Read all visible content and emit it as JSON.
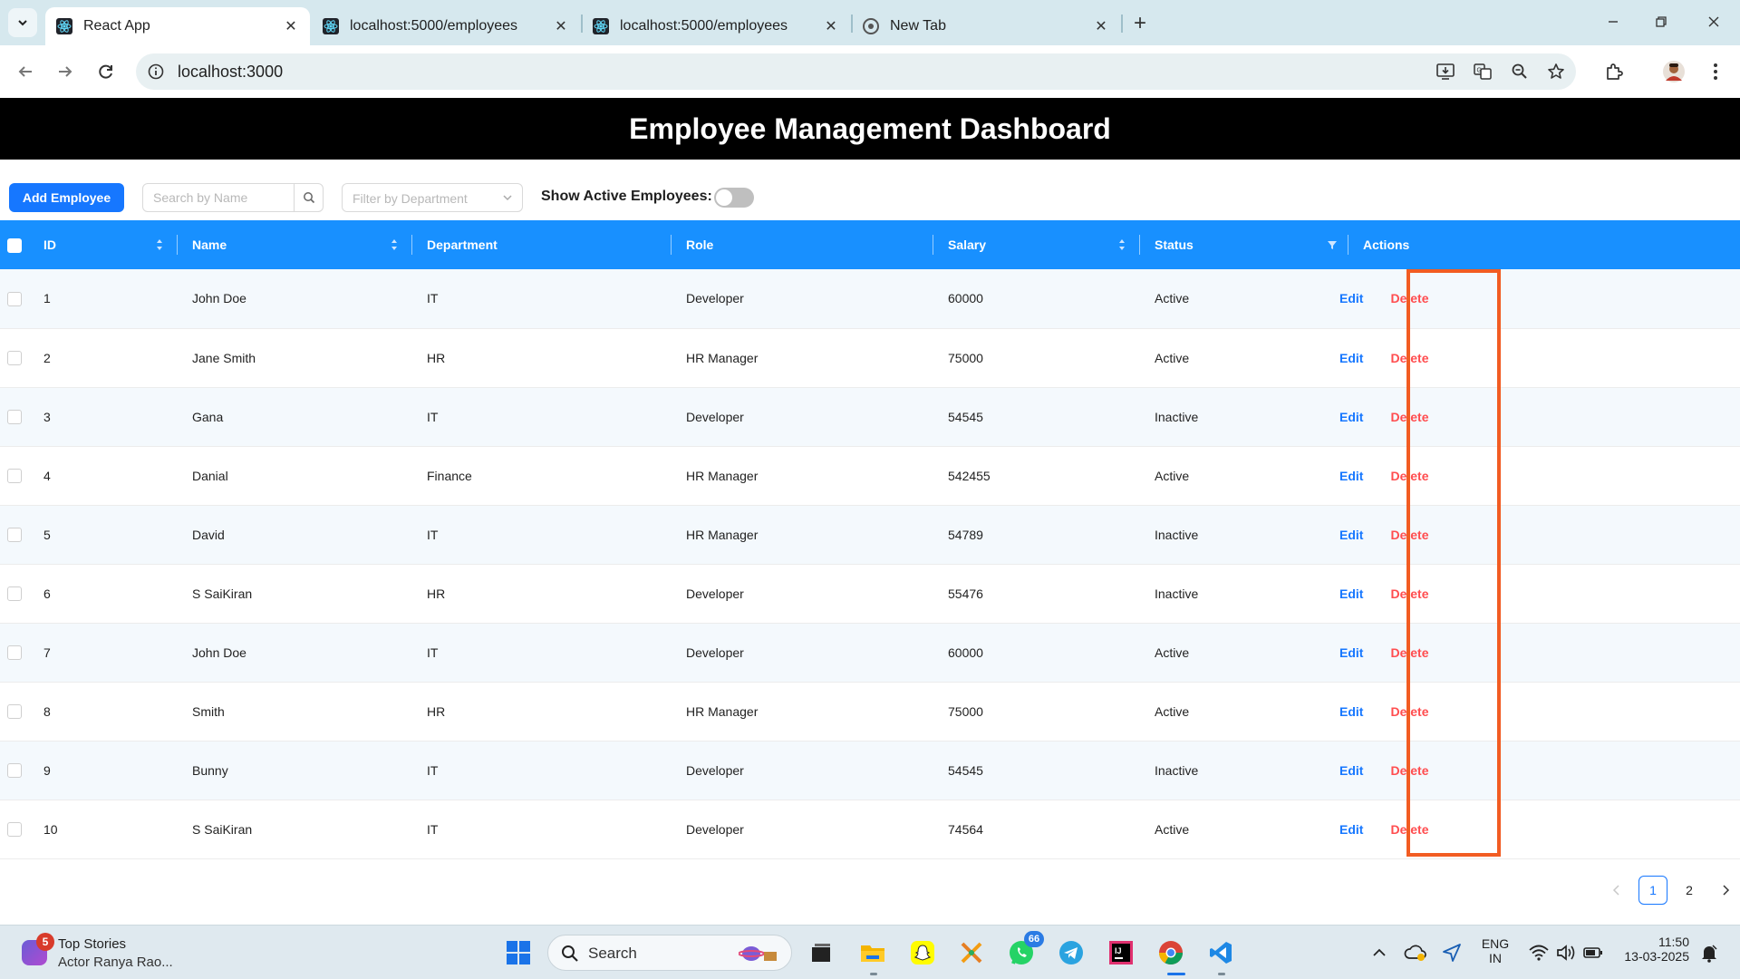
{
  "browser": {
    "tabs": [
      {
        "title": "React App",
        "active": true,
        "icon": "react-icon"
      },
      {
        "title": "localhost:5000/employees",
        "active": false,
        "icon": "react-icon"
      },
      {
        "title": "localhost:5000/employees",
        "active": false,
        "icon": "react-icon"
      },
      {
        "title": "New Tab",
        "active": false,
        "icon": "chrome-icon"
      }
    ],
    "url": "localhost:3000"
  },
  "app": {
    "title": "Employee Management Dashboard",
    "add_button": "Add Employee",
    "search_placeholder": "Search by Name",
    "department_placeholder": "Filter by Department",
    "active_toggle_label": "Show Active Employees:",
    "active_toggle_on": false,
    "columns": [
      "ID",
      "Name",
      "Department",
      "Role",
      "Salary",
      "Status",
      "Actions"
    ],
    "edit_label": "Edit",
    "delete_label": "Delete",
    "rows": [
      {
        "id": "1",
        "name": "John Doe",
        "department": "IT",
        "role": "Developer",
        "salary": "60000",
        "status": "Active"
      },
      {
        "id": "2",
        "name": "Jane Smith",
        "department": "HR",
        "role": "HR Manager",
        "salary": "75000",
        "status": "Active"
      },
      {
        "id": "3",
        "name": "Gana",
        "department": "IT",
        "role": "Developer",
        "salary": "54545",
        "status": "Inactive"
      },
      {
        "id": "4",
        "name": "Danial",
        "department": "Finance",
        "role": "HR Manager",
        "salary": "542455",
        "status": "Active"
      },
      {
        "id": "5",
        "name": "David",
        "department": "IT",
        "role": "HR Manager",
        "salary": "54789",
        "status": "Inactive"
      },
      {
        "id": "6",
        "name": "S SaiKiran",
        "department": "HR",
        "role": "Developer",
        "salary": "55476",
        "status": "Inactive"
      },
      {
        "id": "7",
        "name": "John Doe",
        "department": "IT",
        "role": "Developer",
        "salary": "60000",
        "status": "Active"
      },
      {
        "id": "8",
        "name": "Smith",
        "department": "HR",
        "role": "HR Manager",
        "salary": "75000",
        "status": "Active"
      },
      {
        "id": "9",
        "name": "Bunny",
        "department": "IT",
        "role": "Developer",
        "salary": "54545",
        "status": "Inactive"
      },
      {
        "id": "10",
        "name": "S SaiKiran",
        "department": "IT",
        "role": "Developer",
        "salary": "74564",
        "status": "Active"
      }
    ],
    "pagination": {
      "pages": [
        "1",
        "2"
      ],
      "current": "1"
    },
    "colors": {
      "header_bg": "#000000",
      "table_header": "#1890ff",
      "primary": "#1677ff",
      "danger": "#ff4d4f",
      "highlight": "#f25c22"
    }
  },
  "taskbar": {
    "news_badge": "5",
    "news_title": "Top Stories",
    "news_subtitle": "Actor Ranya Rao...",
    "search_label": "Search",
    "whatsapp_badge": "66",
    "lang_line1": "ENG",
    "lang_line2": "IN",
    "time": "11:50",
    "date": "13-03-2025"
  }
}
